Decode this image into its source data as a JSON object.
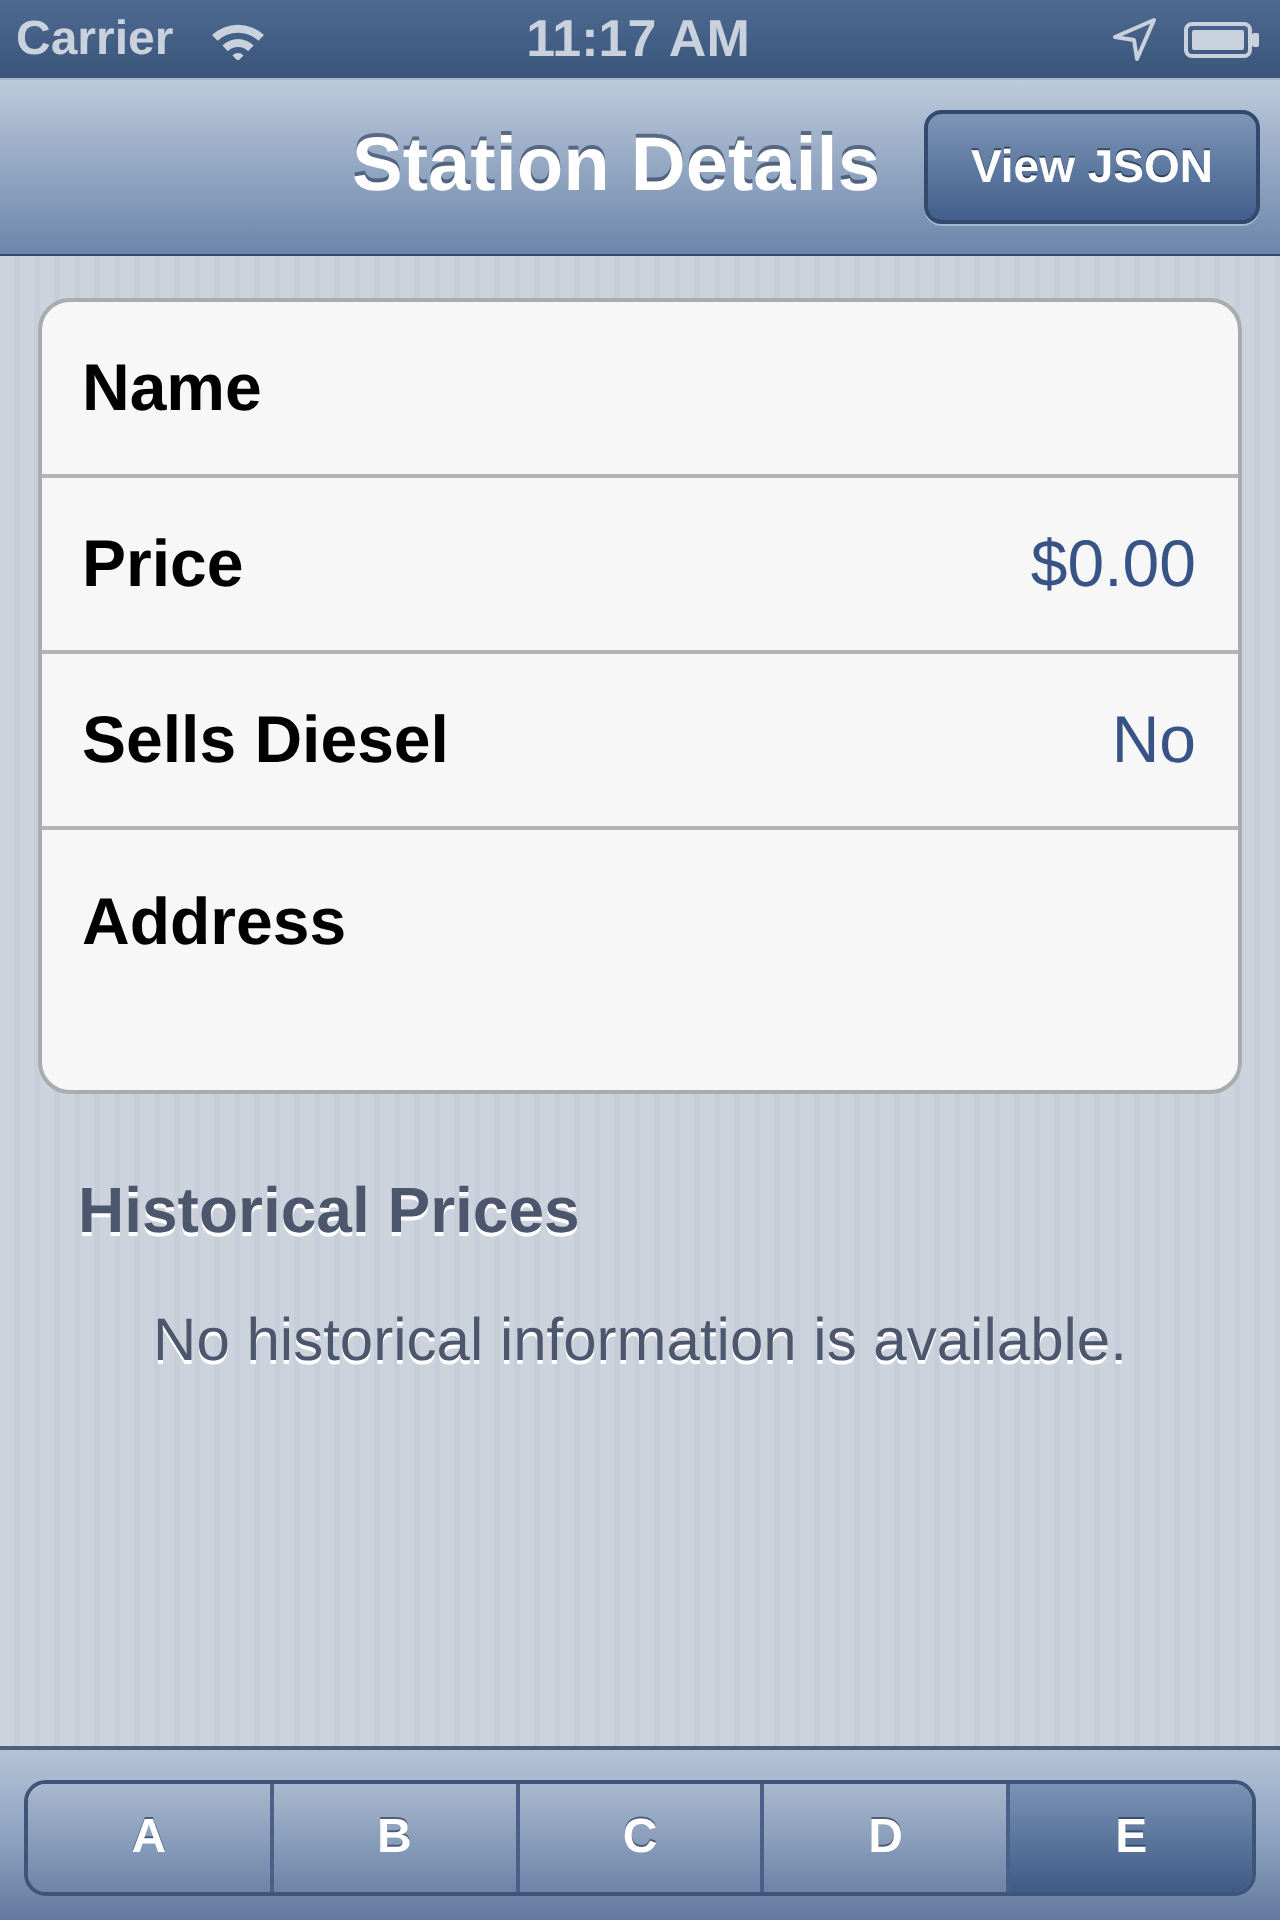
{
  "status_bar": {
    "carrier": "Carrier",
    "time": "11:17 AM"
  },
  "nav_bar": {
    "title": "Station Details",
    "right_button": "View JSON"
  },
  "details": [
    {
      "kind": "single",
      "label": "Name"
    },
    {
      "kind": "single",
      "label": "Price",
      "value": "$0.00"
    },
    {
      "kind": "single",
      "label": "Sells Diesel",
      "value": "No"
    },
    {
      "kind": "multiline",
      "label": "Address"
    }
  ],
  "history": {
    "title": "Historical Prices",
    "empty_message": "No historical information is available."
  },
  "segments": [
    {
      "label": "A",
      "selected": false
    },
    {
      "label": "B",
      "selected": false
    },
    {
      "label": "C",
      "selected": false
    },
    {
      "label": "D",
      "selected": false
    },
    {
      "label": "E",
      "selected": true
    }
  ]
}
